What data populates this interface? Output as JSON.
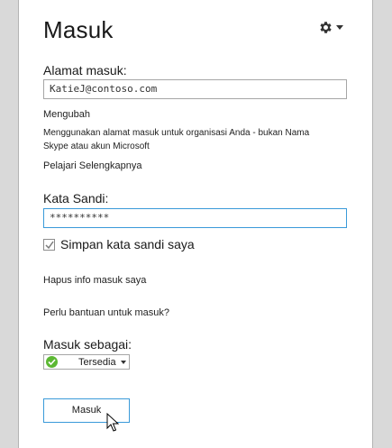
{
  "title": "Masuk",
  "settings": {
    "icon": "gear-icon"
  },
  "address": {
    "label": "Alamat masuk:",
    "value": "KatieJ@contoso.com"
  },
  "change_link": "Mengubah",
  "description": "Menggunakan alamat masuk untuk organisasi Anda - bukan Nama Skype atau akun Microsoft",
  "learn_more": "Pelajari Selengkapnya",
  "password": {
    "label": "Kata Sandi:",
    "value": "**********"
  },
  "remember": {
    "label": "Simpan kata sandi saya",
    "checked": true
  },
  "delete_info": "Hapus info masuk saya",
  "help": "Perlu bantuan untuk masuk?",
  "signin_as": {
    "label": "Masuk sebagai:",
    "status": "Tersedia",
    "status_color": "#5cb833"
  },
  "signin_button": "Masuk",
  "colors": {
    "accent": "#3a9ad9",
    "background": "#d9d9d9"
  }
}
